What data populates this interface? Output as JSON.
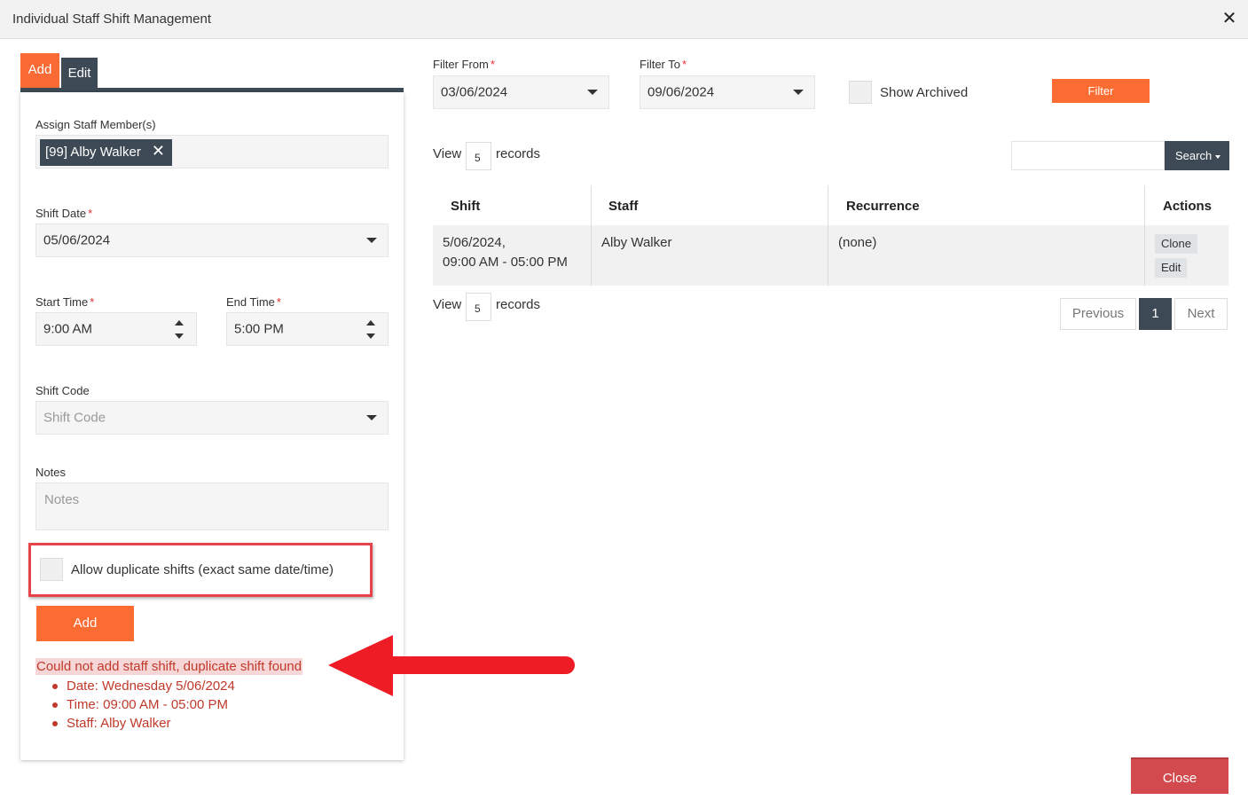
{
  "window": {
    "title": "Individual Staff Shift Management",
    "close_icon": "✕"
  },
  "tabs": [
    {
      "label": "Add",
      "active": true
    },
    {
      "label": "Edit",
      "active": false
    }
  ],
  "form": {
    "assign_label": "Assign Staff Member(s)",
    "selected_staff": "[99] Alby Walker",
    "chip_remove": "✕",
    "shift_date_label": "Shift Date",
    "shift_date_value": "05/06/2024",
    "start_time_label": "Start Time",
    "start_time_value": "9:00 AM",
    "end_time_label": "End Time",
    "end_time_value": "5:00 PM",
    "shift_code_label": "Shift Code",
    "shift_code_placeholder": "Shift Code",
    "notes_label": "Notes",
    "notes_placeholder": "Notes",
    "allow_duplicate_label": "Allow duplicate shifts (exact same date/time)",
    "allow_duplicate_checked": false,
    "add_button": "Add",
    "required_mark": "*"
  },
  "error": {
    "heading": "Could not add staff shift, duplicate shift found",
    "items": [
      "Date: Wednesday 5/06/2024",
      "Time: 09:00 AM - 05:00 PM",
      "Staff: Alby Walker"
    ]
  },
  "filters": {
    "from_label": "Filter From",
    "from_value": "03/06/2024",
    "to_label": "Filter To",
    "to_value": "09/06/2024",
    "show_archived_label": "Show Archived",
    "filter_button": "Filter"
  },
  "records": {
    "view_label": "View",
    "count": "5",
    "records_label": "records"
  },
  "search": {
    "button": "Search"
  },
  "table": {
    "headers": [
      "Shift",
      "Staff",
      "Recurrence",
      "Actions"
    ],
    "rows": [
      {
        "shift_date": "5/06/2024,",
        "shift_time": "09:00 AM - 05:00 PM",
        "staff": "Alby Walker",
        "recurrence": "(none)",
        "clone": "Clone",
        "edit": "Edit"
      }
    ]
  },
  "pagination": {
    "previous": "Previous",
    "current": "1",
    "next": "Next"
  },
  "footer": {
    "close_button": "Close"
  },
  "colors": {
    "accent": "#fb6c33",
    "dark": "#3d4a55",
    "error": "#c0392b",
    "close": "#d24a4d",
    "arrow": "#ee1c25"
  }
}
